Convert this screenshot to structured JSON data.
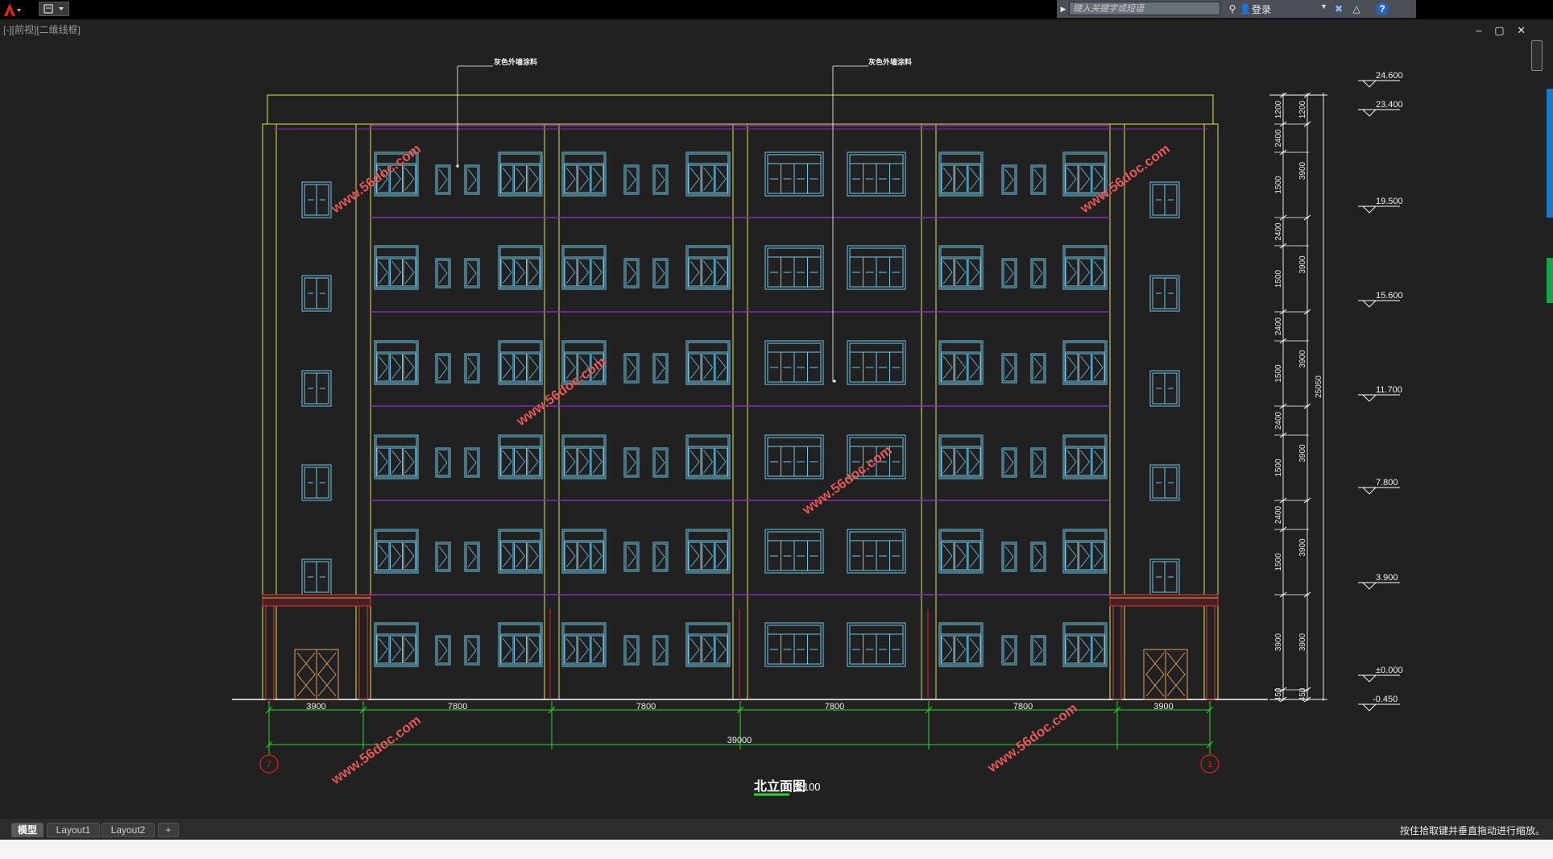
{
  "window": {
    "viewport_label": "[-][前视][二维线框]",
    "search_placeholder": "键入关键字或短语",
    "login_label": "登录",
    "controls": "– ▢ ✕"
  },
  "drawing": {
    "notes": [
      "灰色外墙涂料",
      "灰色外墙涂料"
    ],
    "watermark": "www.56doc.com",
    "title": "北立面图",
    "scale": "1:100",
    "axis_left": "7",
    "axis_right": "1",
    "dims_bottom": [
      "3900",
      "7800",
      "7800",
      "7800",
      "7800",
      "3900"
    ],
    "dim_total": "39000",
    "dims_right": [
      "1200",
      "2400",
      "1500",
      "2400",
      "1500",
      "2400",
      "1500",
      "2400",
      "1500",
      "2400",
      "1500",
      "3900",
      "450"
    ],
    "dims_right_floor": [
      "1200",
      "3900",
      "3900",
      "3900",
      "3900",
      "3900",
      "3900",
      "450"
    ],
    "dim_right_total": "25050",
    "levels": [
      "24.600",
      "23.400",
      "19.500",
      "15.600",
      "11.700",
      "7.800",
      "3.900",
      "±0.000",
      "-0.450"
    ]
  },
  "tabs": [
    "模型",
    "Layout1",
    "Layout2",
    "+"
  ],
  "status_text": "按住拾取键并垂直拖动进行缩放。",
  "colors": {
    "background": "#212121",
    "facade": "#e3e34a",
    "window": "#6fc6e8",
    "floor_line": "#8a2bb8",
    "dimension": "#2bd62b",
    "axis": "#e02020",
    "door": "#e8a060",
    "watermark": "#ff6a6a"
  }
}
